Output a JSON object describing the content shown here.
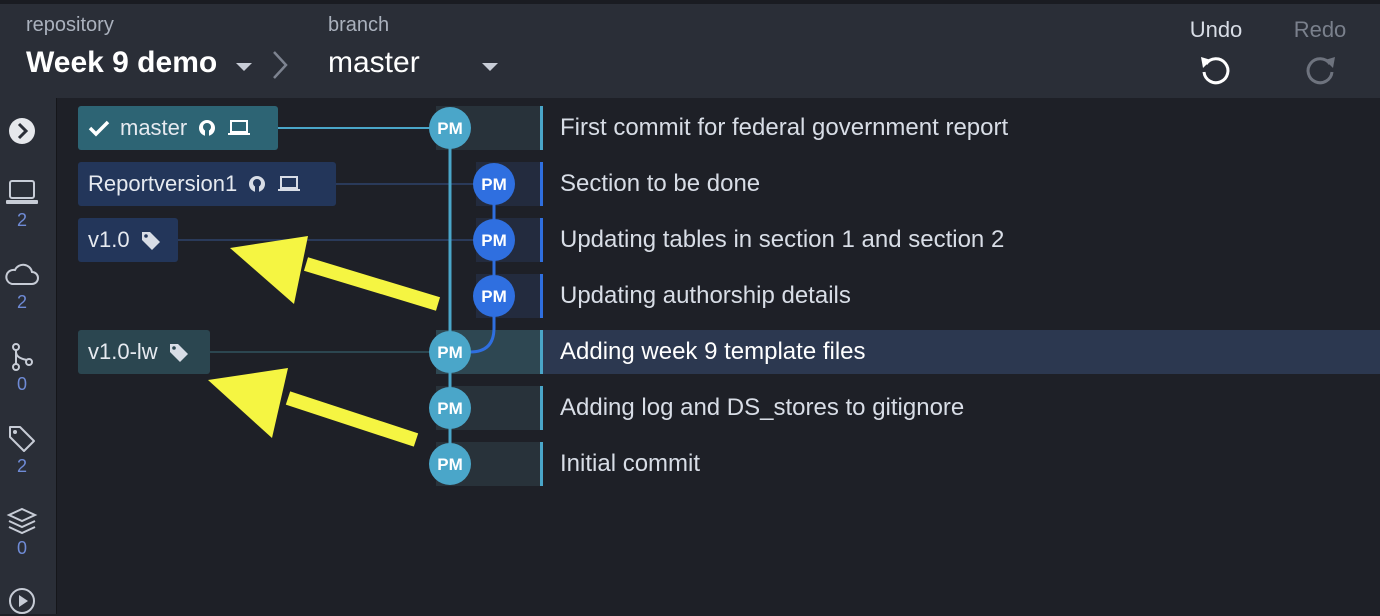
{
  "toolbar": {
    "repository_label": "repository",
    "repository_name": "Week 9 demo",
    "branch_label": "branch",
    "branch_name": "master",
    "undo_label": "Undo",
    "redo_label": "Redo",
    "undo_icon": "undo-icon",
    "redo_icon": "redo-icon"
  },
  "sidebar": {
    "items": [
      {
        "icon": "chevron-right-circle-icon",
        "count": ""
      },
      {
        "icon": "laptop-icon",
        "count": "2"
      },
      {
        "icon": "cloud-icon",
        "count": "2"
      },
      {
        "icon": "pull-request-icon",
        "count": "0"
      },
      {
        "icon": "tag-icon",
        "count": "2"
      },
      {
        "icon": "stack-icon",
        "count": "0"
      },
      {
        "icon": "play-circle-icon",
        "count": ""
      }
    ]
  },
  "refs": [
    {
      "label": "master",
      "type": "branch",
      "checked_out": true,
      "icons": [
        "check-icon",
        "github-icon",
        "laptop-icon"
      ]
    },
    {
      "label": "Reportversion1",
      "type": "branch",
      "checked_out": false,
      "icons": [
        "github-icon",
        "laptop-icon"
      ]
    },
    {
      "label": "v1.0",
      "type": "tag",
      "icons": [
        "tag-icon"
      ]
    },
    {
      "label": "v1.0-lw",
      "type": "tag",
      "icons": [
        "tag-icon"
      ]
    }
  ],
  "commits": [
    {
      "initials": "PM",
      "message": "First commit for federal government report"
    },
    {
      "initials": "PM",
      "message": "Section to be done"
    },
    {
      "initials": "PM",
      "message": "Updating tables in section 1 and section 2"
    },
    {
      "initials": "PM",
      "message": "Updating authorship details"
    },
    {
      "initials": "PM",
      "message": "Adding week 9 template files"
    },
    {
      "initials": "PM",
      "message": "Adding log and DS_stores to gitignore"
    },
    {
      "initials": "PM",
      "message": "Initial commit"
    }
  ],
  "selected_commit": "Adding week 9 template files",
  "colors": {
    "main_lane": "#4aa6c9",
    "branch_lane": "#2f6fe0",
    "annotation_arrow": "#f5f542",
    "selected_row": "#2c3850"
  }
}
